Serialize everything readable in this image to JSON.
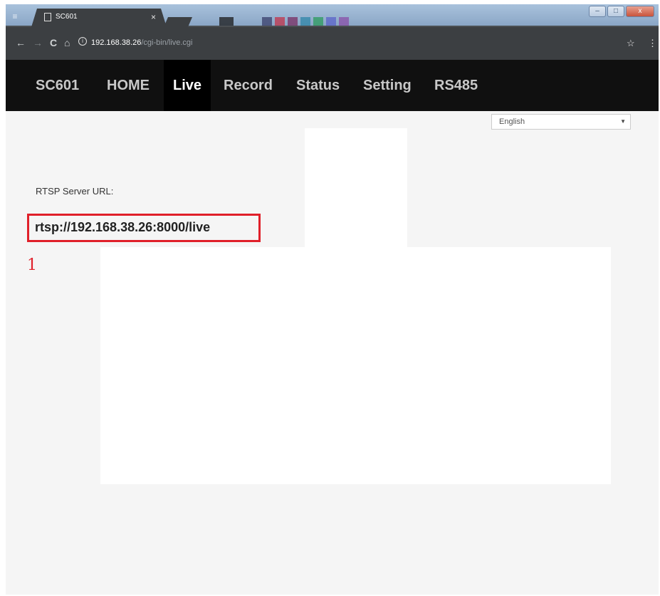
{
  "browser": {
    "tab_title": "SC601",
    "tab_close": "×",
    "url_host": "192.168.38.26",
    "url_path": "/cgi-bin/live.cgi",
    "nav_back": "←",
    "nav_forward": "→",
    "nav_reload": "C",
    "nav_home": "⌂",
    "info_glyph": "i",
    "star_glyph": "☆",
    "menu_glyph": "⋮",
    "minimize_glyph": "–",
    "maximize_glyph": "□",
    "close_glyph": "x",
    "blurred_swatch_colors": [
      "#1b1b1b",
      "#3a3f6b",
      "#c2334a",
      "#7a2d63",
      "#2f86a8",
      "#2c9b5e",
      "#5b63c9",
      "#8a4fa8"
    ]
  },
  "site_nav": {
    "brand": "SC601",
    "items": [
      "HOME",
      "Live",
      "Record",
      "Status",
      "Setting",
      "RS485"
    ],
    "active": "Live"
  },
  "language_select": {
    "selected": "English"
  },
  "live": {
    "rtsp_label": "RTSP Server URL:",
    "rtsp_url": "rtsp://192.168.38.26:8000/live",
    "annotation_number": "1"
  },
  "colors": {
    "nav_background": "#101010",
    "highlight_border": "#e0202a",
    "page_background": "#f5f5f5"
  }
}
